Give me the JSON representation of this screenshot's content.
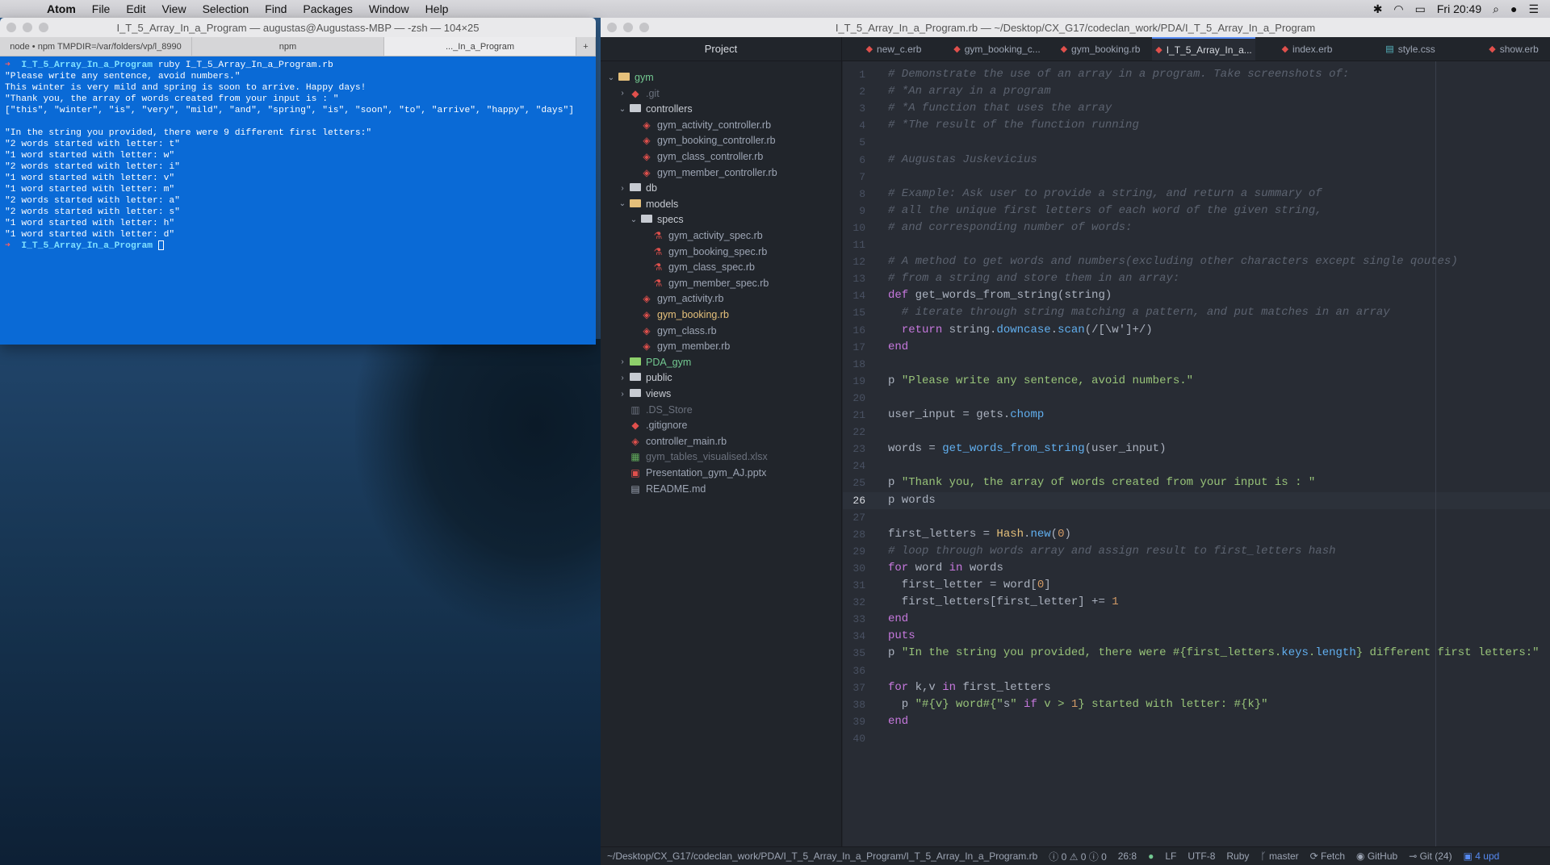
{
  "menubar": {
    "apple": "",
    "app_name": "Atom",
    "menus": [
      "File",
      "Edit",
      "View",
      "Selection",
      "Find",
      "Packages",
      "Window",
      "Help"
    ],
    "clock": "Fri 20:49"
  },
  "terminal": {
    "title": "I_T_5_Array_In_a_Program — augustas@Augustass-MBP — -zsh — 104×25",
    "tabs": [
      "node • npm TMPDIR=/var/folders/vp/l_8990",
      "npm",
      "..._In_a_Program"
    ],
    "new_tab": "+",
    "prompt_dir": "I_T_5_Array_In_a_Program",
    "command": "ruby I_T_5_Array_In_a_Program.rb",
    "output": [
      "\"Please write any sentence, avoid numbers.\"",
      "This winter is very mild and spring is soon to arrive. Happy days!",
      "\"Thank you, the array of words created from your input is : \"",
      "[\"this\", \"winter\", \"is\", \"very\", \"mild\", \"and\", \"spring\", \"is\", \"soon\", \"to\", \"arrive\", \"happy\", \"days\"]",
      "",
      "\"In the string you provided, there were 9 different first letters:\"",
      "\"2 words started with letter: t\"",
      "\"1 word started with letter: w\"",
      "\"2 words started with letter: i\"",
      "\"1 word started with letter: v\"",
      "\"1 word started with letter: m\"",
      "\"2 words started with letter: a\"",
      "\"2 words started with letter: s\"",
      "\"1 word started with letter: h\"",
      "\"1 word started with letter: d\""
    ]
  },
  "atom": {
    "title": "I_T_5_Array_In_a_Program.rb — ~/Desktop/CX_G17/codeclan_work/PDA/I_T_5_Array_In_a_Program",
    "tree_header": "Project",
    "tabs": [
      {
        "label": "new_c.erb",
        "icon": "ruby-icon"
      },
      {
        "label": "gym_booking_c...",
        "icon": "ruby-icon"
      },
      {
        "label": "gym_booking.rb",
        "icon": "ruby-icon"
      },
      {
        "label": "I_T_5_Array_In_a...",
        "icon": "ruby-icon"
      },
      {
        "label": "index.erb",
        "icon": "ruby-icon"
      },
      {
        "label": "style.css",
        "icon": "css-icon"
      },
      {
        "label": "show.erb",
        "icon": "ruby-icon"
      }
    ],
    "tree": [
      {
        "label": "gym",
        "kind": "repo-open"
      },
      {
        "label": ".git",
        "kind": "git-closed"
      },
      {
        "label": "controllers",
        "kind": "folder-open"
      },
      {
        "label": "gym_activity_controller.rb",
        "kind": "ruby"
      },
      {
        "label": "gym_booking_controller.rb",
        "kind": "ruby"
      },
      {
        "label": "gym_class_controller.rb",
        "kind": "ruby"
      },
      {
        "label": "gym_member_controller.rb",
        "kind": "ruby"
      },
      {
        "label": "db",
        "kind": "folder-closed"
      },
      {
        "label": "models",
        "kind": "folder-open"
      },
      {
        "label": "specs",
        "kind": "folder-open"
      },
      {
        "label": "gym_activity_spec.rb",
        "kind": "spec"
      },
      {
        "label": "gym_booking_spec.rb",
        "kind": "spec"
      },
      {
        "label": "gym_class_spec.rb",
        "kind": "spec"
      },
      {
        "label": "gym_member_spec.rb",
        "kind": "spec"
      },
      {
        "label": "gym_activity.rb",
        "kind": "ruby"
      },
      {
        "label": "gym_booking.rb",
        "kind": "ruby"
      },
      {
        "label": "gym_class.rb",
        "kind": "ruby"
      },
      {
        "label": "gym_member.rb",
        "kind": "ruby"
      },
      {
        "label": "PDA_gym",
        "kind": "folder-closed"
      },
      {
        "label": "public",
        "kind": "folder-closed"
      },
      {
        "label": "views",
        "kind": "folder-closed"
      },
      {
        "label": ".DS_Store",
        "kind": "file"
      },
      {
        "label": ".gitignore",
        "kind": "git"
      },
      {
        "label": "controller_main.rb",
        "kind": "ruby"
      },
      {
        "label": "gym_tables_visualised.xlsx",
        "kind": "xlsx"
      },
      {
        "label": "Presentation_gym_AJ.pptx",
        "kind": "pptx"
      },
      {
        "label": "README.md",
        "kind": "md"
      }
    ],
    "code_lines": [
      "# Demonstrate the use of an array in a program. Take screenshots of:",
      "# *An array in a program",
      "# *A function that uses the array",
      "# *The result of the function running",
      "",
      "# Augustas Juskevicius",
      "",
      "# Example: Ask user to provide a string, and return a summary of",
      "# all the unique first letters of each word of the given string,",
      "# and corresponding number of words:",
      "",
      "# A method to get words and numbers(excluding other characters except single qoutes)",
      "# from a string and store them in an array:",
      "def get_words_from_string(string)",
      "  # iterate through string matching a pattern, and put matches in an array",
      "  return string.downcase.scan(/[\\w']+/)",
      "end",
      "",
      "p \"Please write any sentence, avoid numbers.\"",
      "",
      "user_input = gets.chomp",
      "",
      "words = get_words_from_string(user_input)",
      "",
      "p \"Thank you, the array of words created from your input is : \"",
      "p words",
      "",
      "first_letters = Hash.new(0)",
      "# loop through words array and assign result to first_letters hash",
      "for word in words",
      "  first_letter = word[0]",
      "  first_letters[first_letter] += 1",
      "end",
      "puts",
      "p \"In the string you provided, there were #{first_letters.keys.length} different first letters:\"",
      "",
      "for k,v in first_letters",
      "  p \"#{v} word#{\"s\" if v > 1} started with letter: #{k}\"",
      "end",
      ""
    ],
    "status": {
      "path": "~/Desktop/CX_G17/codeclan_work/PDA/I_T_5_Array_In_a_Program/I_T_5_Array_In_a_Program.rb",
      "lint": "0 ⚠ 0 ⓘ 0",
      "cursor": "26:8",
      "line_ending": "LF",
      "encoding": "UTF-8",
      "grammar": "Ruby",
      "branch": "master",
      "fetch": "Fetch",
      "github": "GitHub",
      "git": "Git (24)",
      "updates": "4 upd"
    }
  }
}
